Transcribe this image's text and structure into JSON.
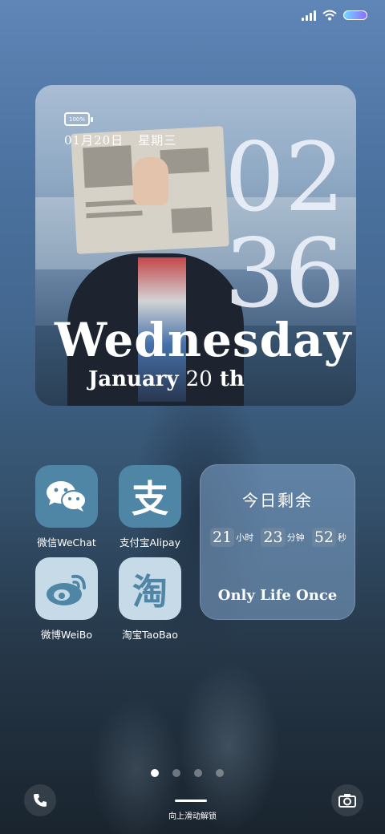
{
  "status_bar": {
    "signal_icon": "signal-bars-icon",
    "wifi_icon": "wifi-icon",
    "battery_icon": "battery-pill-icon",
    "battery_gradient": [
      "#6fd9ff",
      "#8f6bff"
    ]
  },
  "clock_widget": {
    "battery_label": "100%",
    "date": "01月20日",
    "weekday_cn": "星期三",
    "hour": "02",
    "minute": "36",
    "weekday_en": "Wednesday",
    "month_day_prefix": "January ",
    "month_day_num": "20",
    "month_day_suffix": " th"
  },
  "apps": [
    {
      "label": "微信WeChat",
      "icon": "wechat-icon"
    },
    {
      "label": "支付宝Alipay",
      "icon": "alipay-icon",
      "glyph": "支"
    },
    {
      "label": "微博WeiBo",
      "icon": "weibo-icon"
    },
    {
      "label": "淘宝TaoBao",
      "icon": "taobao-icon",
      "glyph": "淘"
    }
  ],
  "countdown_widget": {
    "title": "今日剩余",
    "hours": "21",
    "hours_unit": "小时",
    "minutes": "23",
    "minutes_unit": "分钟",
    "seconds": "52",
    "seconds_unit": "秒",
    "motto": "Only Life Once"
  },
  "page_indicator": {
    "count": 4,
    "active_index": 0
  },
  "bottom": {
    "phone_icon": "phone-icon",
    "camera_icon": "camera-icon",
    "unlock_hint": "向上滑动解锁"
  }
}
